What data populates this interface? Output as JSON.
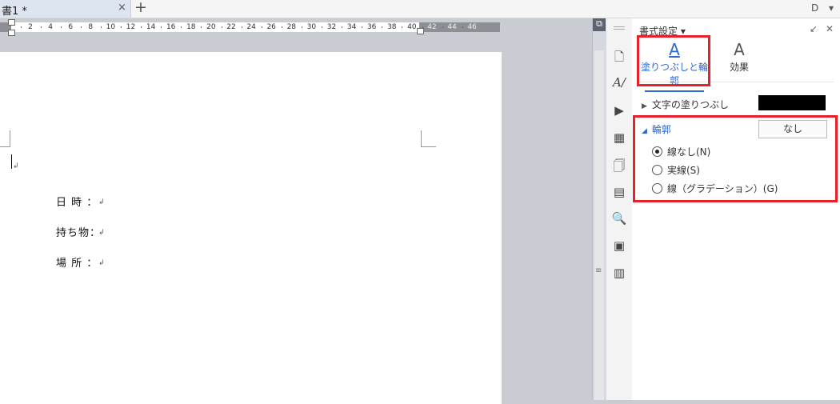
{
  "tabbar": {
    "doc_tab_title": "書1 *",
    "close_glyph": "×",
    "new_tab_glyph": "+",
    "right_icons": [
      "D",
      "▾"
    ]
  },
  "ruler": {
    "labels": [
      "2",
      "4",
      "6",
      "8",
      "10",
      "12",
      "14",
      "16",
      "18",
      "20",
      "22",
      "24",
      "26",
      "28",
      "30",
      "32",
      "34",
      "36",
      "38",
      "40",
      "42",
      "44",
      "46"
    ]
  },
  "document": {
    "lines": [
      {
        "label": "日 時 ：",
        "mark": "↲"
      },
      {
        "label": "持ち物：",
        "mark": "↲"
      },
      {
        "label": "場 所 ：",
        "mark": "↲"
      }
    ],
    "empty_line_mark": "↲"
  },
  "strip_icons": [
    "page-icon",
    "spelling-icon",
    "insert-icon",
    "layout-icon",
    "document-icon",
    "text-box-icon",
    "format-settings-icon",
    "image-icon",
    "table-icon"
  ],
  "panel": {
    "title": "書式設定 ▾",
    "tabs": [
      {
        "label": "塗りつぶしと輪郭",
        "glyph": "A",
        "active": true
      },
      {
        "label": "効果",
        "glyph": "A",
        "active": false
      }
    ],
    "text_fill": {
      "label": "文字の塗りつぶし",
      "color": "#000000"
    },
    "outline": {
      "label": "輪郭",
      "button": "なし",
      "options": [
        {
          "label": "線なし(N)",
          "selected": true
        },
        {
          "label": "実線(S)",
          "selected": false
        },
        {
          "label": "線（グラデーション）(G)",
          "selected": false
        }
      ]
    }
  },
  "colors": {
    "accent": "#2f6ad1",
    "highlight": "#e8202a"
  }
}
